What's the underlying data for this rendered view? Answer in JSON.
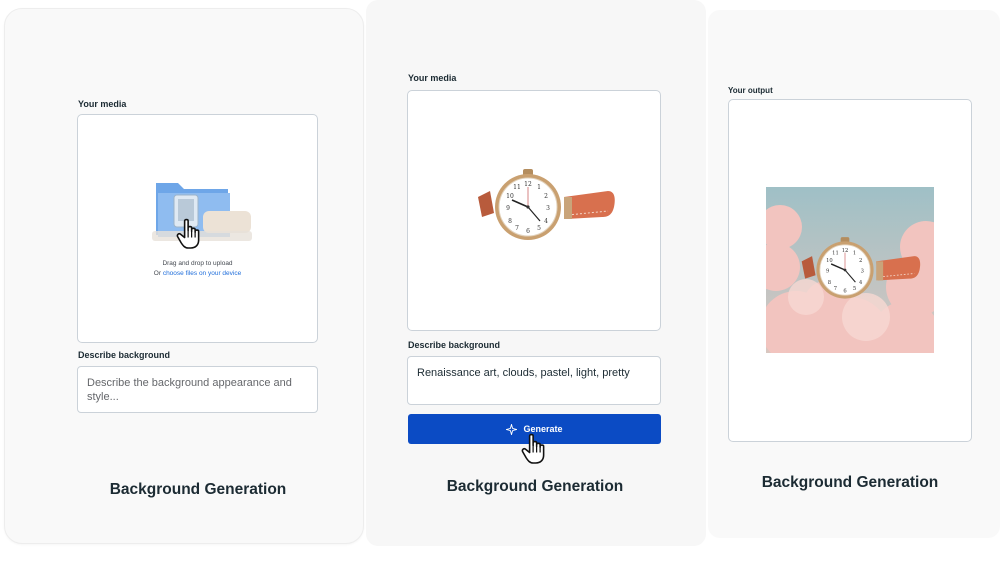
{
  "panels": [
    {
      "media_label": "Your media",
      "upload_text": "Drag and drop to upload",
      "upload_prefix": "Or",
      "upload_link": "choose files on your device",
      "describe_label": "Describe background",
      "describe_placeholder": "Describe the background appearance and style...",
      "caption": "Background Generation"
    },
    {
      "media_label": "Your media",
      "describe_label": "Describe background",
      "describe_value": "Renaissance art, clouds, pastel, light, pretty",
      "generate_label": "Generate",
      "caption": "Background Generation"
    },
    {
      "output_label": "Your output",
      "caption": "Background Generation"
    }
  ],
  "colors": {
    "button_blue": "#0b4bc4",
    "link_blue": "#216fdb",
    "watch_strap": "#d8704e",
    "cloud_pink": "#f2c4bf",
    "sky_blue": "#a9c6cc"
  },
  "icons": [
    "folder-icon",
    "hand-cursor-icon",
    "sparkle-icon",
    "watch-image",
    "watch-clouds-image"
  ]
}
